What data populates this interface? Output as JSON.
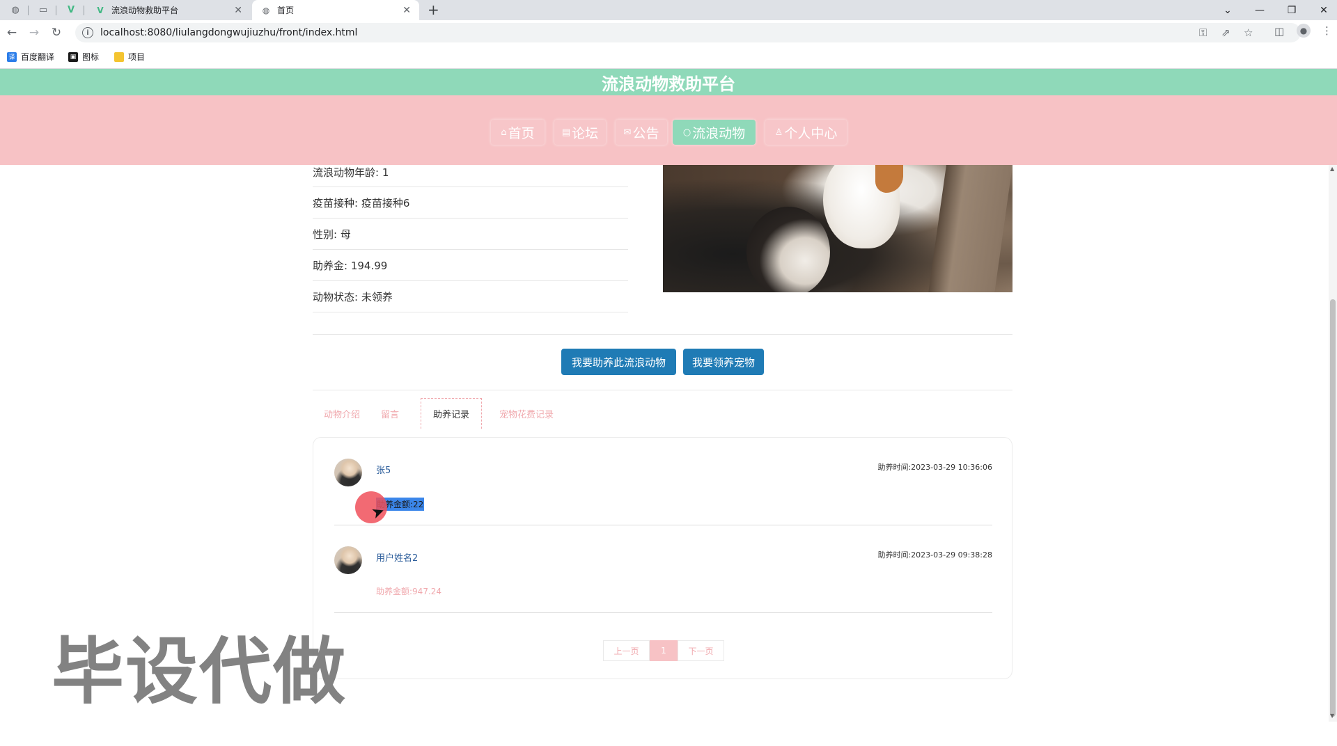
{
  "browser": {
    "tabs": [
      {
        "title": "流浪动物救助平台",
        "active": false
      },
      {
        "title": "首页",
        "active": true
      }
    ],
    "new_tab": "+",
    "url": "localhost:8080/liulangdongwujiuzhu/front/index.html",
    "bookmarks": [
      "百度翻译",
      "图标",
      "项目"
    ],
    "window_controls": [
      "⌄",
      "—",
      "❐",
      "✕"
    ]
  },
  "site": {
    "title": "流浪动物救助平台",
    "nav": [
      {
        "icon": "home-icon",
        "glyph": "⌂",
        "label": "首页",
        "active": false
      },
      {
        "icon": "forum-icon",
        "glyph": "▤",
        "label": "论坛",
        "active": false
      },
      {
        "icon": "mail-icon",
        "glyph": "✉",
        "label": "公告",
        "active": false
      },
      {
        "icon": "circle-icon",
        "glyph": "○",
        "label": "流浪动物",
        "active": true
      },
      {
        "icon": "user-icon",
        "glyph": "♙",
        "label": "个人中心",
        "active": false
      }
    ]
  },
  "detail": {
    "fields": [
      "流浪动物年龄: 1",
      "疫苗接种: 疫苗接种6",
      "性别: 母",
      "助养金: 194.99",
      "动物状态: 未领养"
    ]
  },
  "actions": {
    "sponsor_label": "我要助养此流浪动物",
    "adopt_label": "我要领养宠物"
  },
  "content_tabs": [
    {
      "label": "动物介绍",
      "active": false
    },
    {
      "label": "留言",
      "active": false
    },
    {
      "label": "助养记录",
      "active": true
    },
    {
      "label": "宠物花费记录",
      "active": false
    }
  ],
  "records": [
    {
      "name": "张5",
      "time": "助养时间:2023-03-29 10:36:06",
      "amount": "助养金额:22",
      "selected": true
    },
    {
      "name": "用户姓名2",
      "time": "助养时间:2023-03-29 09:38:28",
      "amount": "助养金额:947.24",
      "selected": false
    }
  ],
  "pager": {
    "prev": "上一页",
    "current": "1",
    "next": "下一页"
  },
  "watermark": "毕设代做",
  "colors": {
    "header_green": "#8fd9b9",
    "nav_pink": "#f7c2c5",
    "button_blue": "#1f7bb5",
    "accent_pink": "#f0a8ad"
  }
}
